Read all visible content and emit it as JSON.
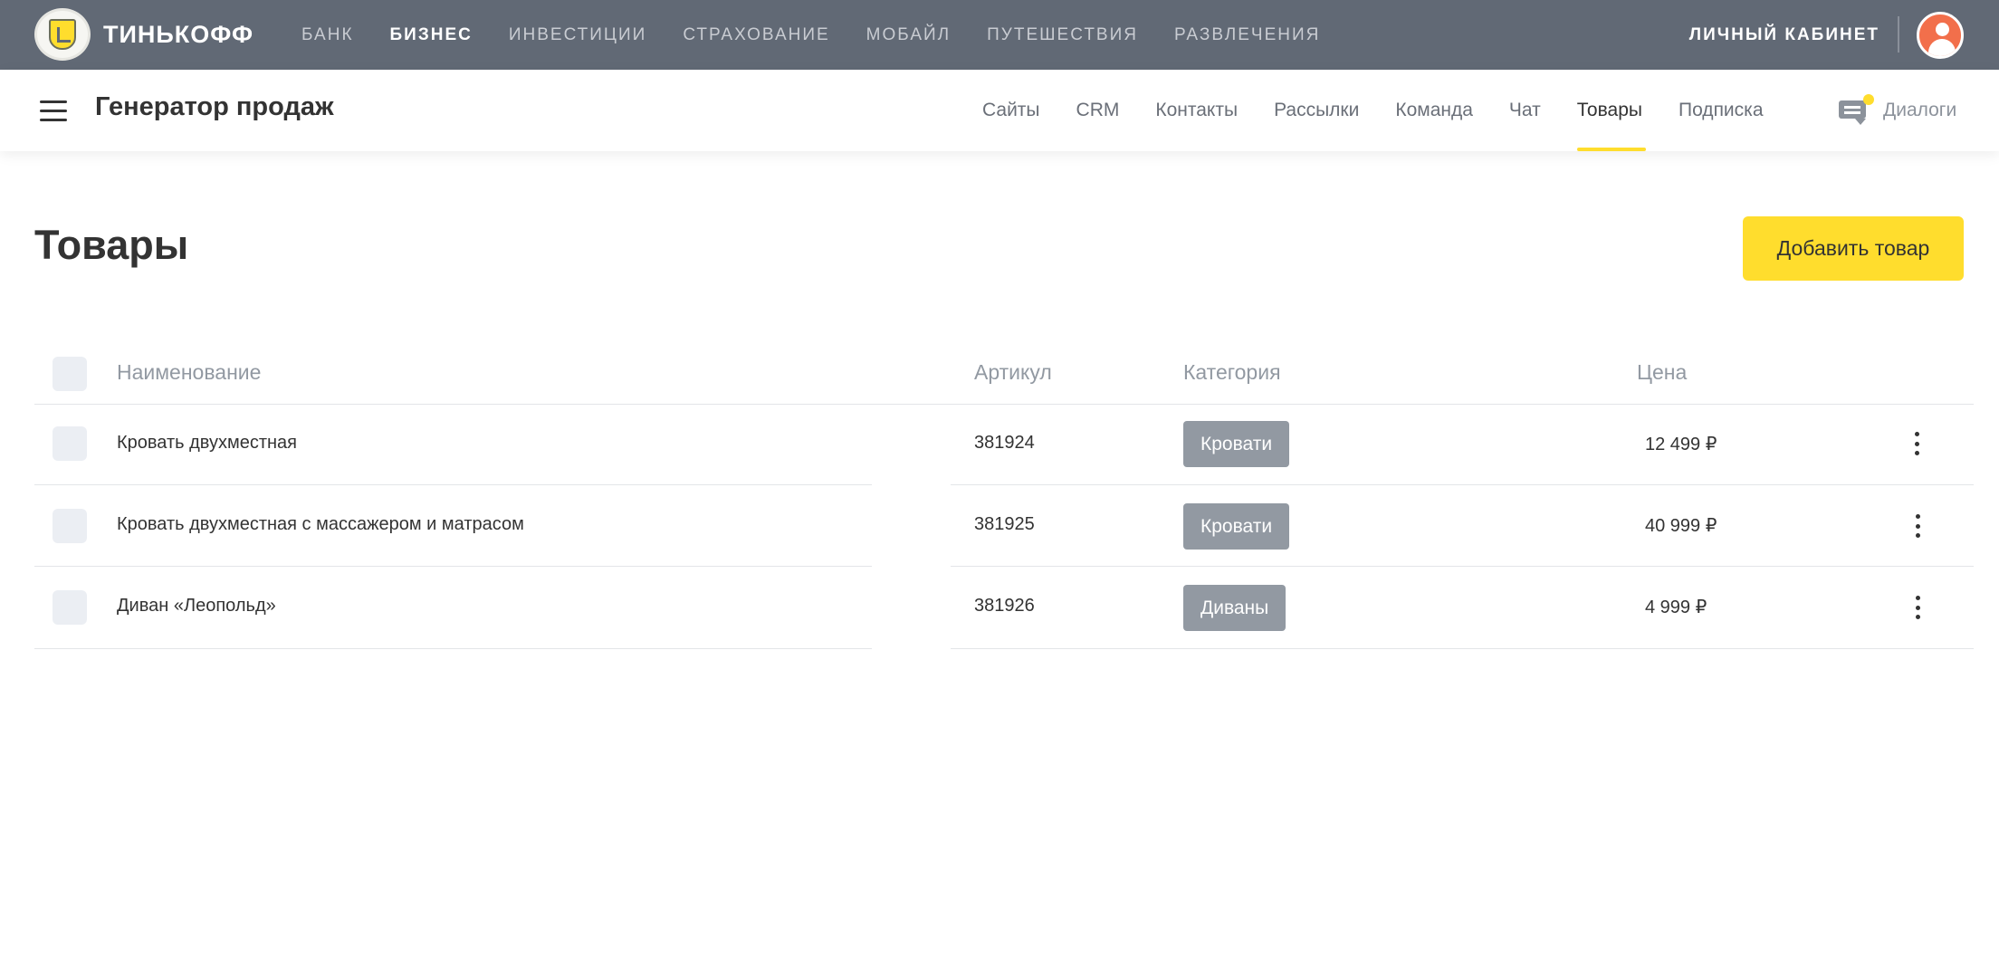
{
  "topbar": {
    "brand": "ТИНЬКОФФ",
    "nav": [
      {
        "label": "БАНК",
        "active": false
      },
      {
        "label": "БИЗНЕС",
        "active": true
      },
      {
        "label": "ИНВЕСТИЦИИ",
        "active": false
      },
      {
        "label": "СТРАХОВАНИЕ",
        "active": false
      },
      {
        "label": "МОБАЙЛ",
        "active": false
      },
      {
        "label": "ПУТЕШЕСТВИЯ",
        "active": false
      },
      {
        "label": "РАЗВЛЕЧЕНИЯ",
        "active": false
      }
    ],
    "cabinet_label": "ЛИЧНЫЙ КАБИНЕТ"
  },
  "subheader": {
    "app_title": "Генератор продаж",
    "tabs": [
      {
        "label": "Сайты",
        "active": false
      },
      {
        "label": "CRM",
        "active": false
      },
      {
        "label": "Контакты",
        "active": false
      },
      {
        "label": "Рассылки",
        "active": false
      },
      {
        "label": "Команда",
        "active": false
      },
      {
        "label": "Чат",
        "active": false
      },
      {
        "label": "Товары",
        "active": true
      },
      {
        "label": "Подписка",
        "active": false
      }
    ],
    "dialogs_label": "Диалоги"
  },
  "main": {
    "title": "Товары",
    "add_button_label": "Добавить товар",
    "table": {
      "headers": {
        "name": "Наименование",
        "sku": "Артикул",
        "category": "Категория",
        "price": "Цена"
      },
      "rows": [
        {
          "name": "Кровать двухместная",
          "sku": "381924",
          "category": "Кровати",
          "price": "12 499 ₽"
        },
        {
          "name": "Кровать двухместная с массажером и матрасом",
          "sku": "381925",
          "category": "Кровати",
          "price": "40 999 ₽"
        },
        {
          "name": "Диван «Леопольд»",
          "sku": "381926",
          "category": "Диваны",
          "price": "4 999 ₽"
        }
      ]
    }
  },
  "colors": {
    "topbar_bg": "#616975",
    "accent_yellow": "#ffdd2d",
    "badge_gray": "#9299a2",
    "avatar_orange": "#f26f4b"
  }
}
